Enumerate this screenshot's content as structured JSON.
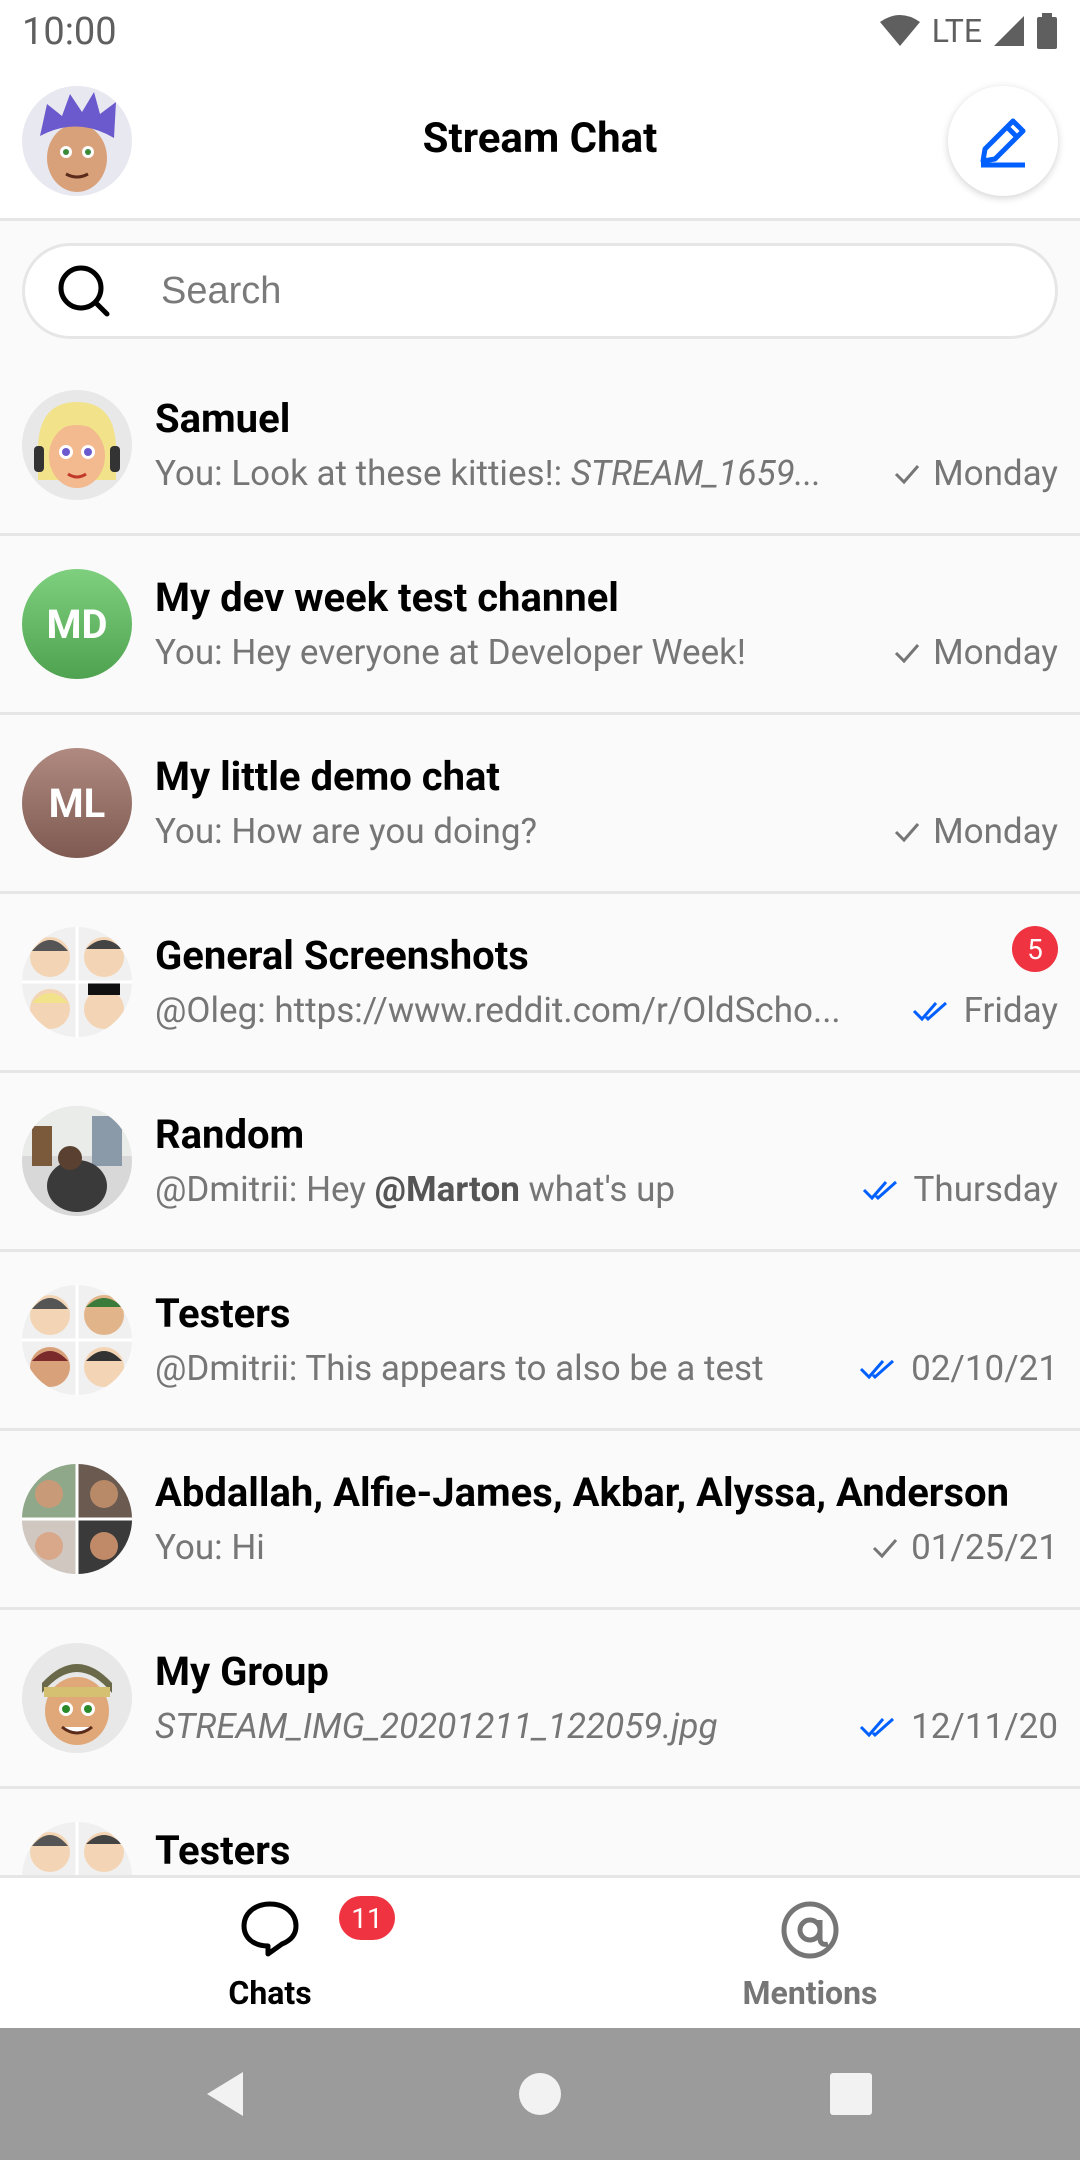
{
  "status_bar": {
    "time": "10:00",
    "network": "LTE"
  },
  "header": {
    "title": "Stream Chat"
  },
  "search": {
    "placeholder": "Search"
  },
  "channels": [
    {
      "name": "Samuel",
      "preview_prefix": "You: Look at these kitties!: ",
      "preview_italic": "STREAM_1659...",
      "status": "sent",
      "time": "Monday"
    },
    {
      "name": "My dev week test channel",
      "initials": "MD",
      "preview": "You: Hey everyone at Developer Week!",
      "status": "sent",
      "time": "Monday"
    },
    {
      "name": "My little demo chat",
      "initials": "ML",
      "preview": "You: How are you doing?",
      "status": "sent",
      "time": "Monday"
    },
    {
      "name": "General Screenshots",
      "preview": "@Oleg: https://www.reddit.com/r/OldScho...",
      "status": "read",
      "time": "Friday",
      "unread": "5"
    },
    {
      "name": "Random",
      "preview_prefix": "@Dmitrii: Hey ",
      "preview_mention": "@Marton",
      "preview_suffix": " what's up",
      "status": "read",
      "time": "Thursday"
    },
    {
      "name": "Testers",
      "preview": "@Dmitrii: This appears to also be a test",
      "status": "read",
      "time": "02/10/21"
    },
    {
      "name": "Abdallah, Alfie-James, Akbar, Alyssa, Anderson",
      "preview": "You: Hi",
      "status": "sent",
      "time": "01/25/21"
    },
    {
      "name": "My Group",
      "preview_italic": "STREAM_IMG_20201211_122059.jpg",
      "status": "read",
      "time": "12/11/20"
    },
    {
      "name": "Testers"
    }
  ],
  "tabs": [
    {
      "label": "Chats",
      "badge": "11"
    },
    {
      "label": "Mentions"
    }
  ],
  "colors": {
    "accent": "#005fff",
    "badge": "#ef3340",
    "muted": "#767676"
  }
}
